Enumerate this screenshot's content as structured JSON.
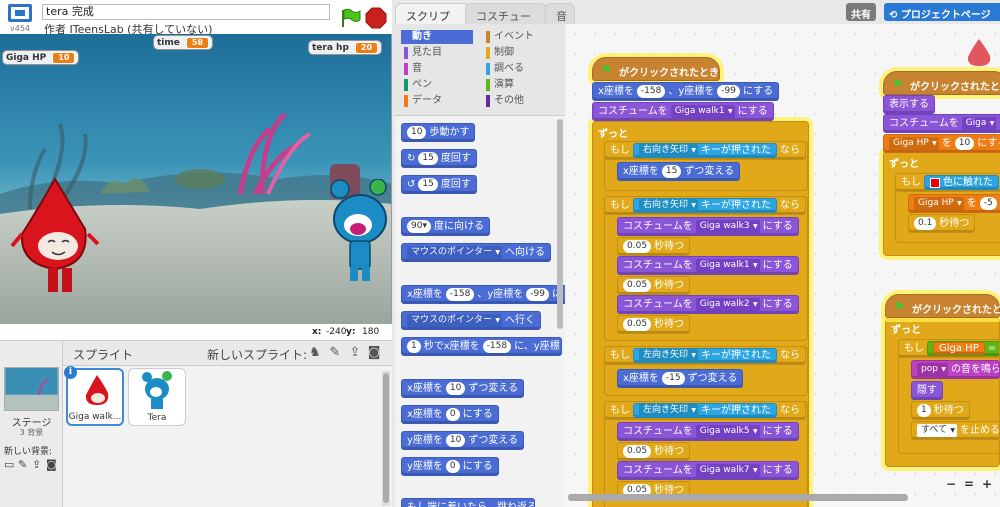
{
  "header": {
    "version": "v454",
    "project_title": "tera 完成",
    "author_line": "作者 ITeensLab (共有していない)"
  },
  "stage": {
    "monitors": [
      {
        "label": "Giga HP",
        "value": "10"
      },
      {
        "label": "time",
        "value": "58"
      },
      {
        "label": "tera hp",
        "value": "20"
      }
    ],
    "x_label": "x:",
    "x_value": "-240",
    "y_label": "y:",
    "y_value": "180"
  },
  "sprites": {
    "title": "スプライト",
    "new_sprite_label": "新しいスプライト:",
    "stage_label": "ステージ",
    "stage_backdrops": "3 背景",
    "new_backdrop_label": "新しい背景:",
    "items": [
      {
        "name": "Giga walk...",
        "selected": true
      },
      {
        "name": "Tera",
        "selected": false
      }
    ]
  },
  "tabs": [
    "スクリプト",
    "コスチューム",
    "音"
  ],
  "top_right": {
    "share": "共有",
    "project_page": "プロジェクトページ"
  },
  "categories": [
    {
      "label": "動き",
      "color": "#4a6cd4",
      "active": true
    },
    {
      "label": "見た目",
      "color": "#8a55d7"
    },
    {
      "label": "音",
      "color": "#bb42c3"
    },
    {
      "label": "ペン",
      "color": "#0e9a6c"
    },
    {
      "label": "データ",
      "color": "#ee7d16"
    },
    {
      "label": "イベント",
      "color": "#c88330"
    },
    {
      "label": "制御",
      "color": "#e1a91a"
    },
    {
      "label": "調べる",
      "color": "#2ca5e2"
    },
    {
      "label": "演算",
      "color": "#5cb712"
    },
    {
      "label": "その他",
      "color": "#632d99"
    }
  ],
  "palette": {
    "move": {
      "n": "10",
      "t": "歩動かす"
    },
    "turn_r": {
      "n": "15",
      "t": "度回す"
    },
    "turn_l": {
      "n": "15",
      "t": "度回す"
    },
    "point_dir": {
      "n": "90▾",
      "t": "度に向ける"
    },
    "point_towards": {
      "dd": "マウスのポインター",
      "t": "へ向ける"
    },
    "goto_xy": {
      "a": "x座標を",
      "x": "-158",
      "b": "、y座標を",
      "y": "-99",
      "c": "に"
    },
    "goto": {
      "dd": "マウスのポインター",
      "t": "へ行く"
    },
    "glide": {
      "n": "1",
      "a": "秒でx座標を",
      "x": "-158",
      "b": "に、y座標を"
    },
    "change_x": {
      "a": "x座標を",
      "n": "10",
      "b": "ずつ変える"
    },
    "set_x": {
      "a": "x座標を",
      "n": "0",
      "b": "にする"
    },
    "change_y": {
      "a": "y座標を",
      "n": "10",
      "b": "ずつ変える"
    },
    "set_y": {
      "a": "y座標を",
      "n": "0",
      "b": "にする"
    },
    "partial": "もし端に着いたら、跳ね返る"
  },
  "script1": {
    "hat": "がクリックされたとき",
    "goto": {
      "a": "x座標を",
      "x": "-158",
      "b": "、y座標を",
      "y": "-99",
      "c": "にする"
    },
    "costume": {
      "a": "コスチュームを",
      "dd": "Giga walk1",
      "b": "にする"
    },
    "forever": "ずっと",
    "if1": {
      "a": "もし",
      "key": "右向き矢印",
      "b": "キーが押された",
      "c": "なら"
    },
    "change1": {
      "a": "x座標を",
      "n": "15",
      "b": "ずつ変える"
    },
    "if2": {
      "a": "もし",
      "key": "右向き矢印",
      "b": "キーが押された",
      "c": "なら"
    },
    "seq": [
      {
        "a": "コスチュームを",
        "dd": "Giga walk3",
        "b": "にする"
      },
      {
        "n": "0.05",
        "t": "秒待つ"
      },
      {
        "a": "コスチュームを",
        "dd": "Giga walk1",
        "b": "にする"
      },
      {
        "n": "0.05",
        "t": "秒待つ"
      },
      {
        "a": "コスチュームを",
        "dd": "Giga walk2",
        "b": "にする"
      },
      {
        "n": "0.05",
        "t": "秒待つ"
      }
    ],
    "if3": {
      "a": "もし",
      "key": "左向き矢印",
      "b": "キーが押された",
      "c": "なら"
    },
    "change2": {
      "a": "x座標を",
      "n": "-15",
      "b": "ずつ変える"
    },
    "if4": {
      "a": "もし",
      "key": "左向き矢印",
      "b": "キーが押された",
      "c": "なら"
    },
    "seq2": [
      {
        "a": "コスチュームを",
        "dd": "Giga walk5",
        "b": "にする"
      },
      {
        "n": "0.05",
        "t": "秒待つ"
      },
      {
        "a": "コスチュームを",
        "dd": "Giga walk7",
        "b": "にする"
      },
      {
        "n": "0.05",
        "t": "秒待つ"
      }
    ]
  },
  "script2": {
    "hat": "がクリックされたとき",
    "show": "表示する",
    "costume": {
      "a": "コスチュームを",
      "dd": "Giga"
    },
    "setvar": {
      "dd": "Giga HP",
      "a": "を",
      "n": "10",
      "b": "にする"
    },
    "forever": "ずっと",
    "if": {
      "a": "もし",
      "b": "色に触れた"
    },
    "changevar": {
      "dd": "Giga HP",
      "a": "を",
      "n": "-5"
    },
    "wait": {
      "n": "0.1",
      "t": "秒待つ"
    }
  },
  "script3": {
    "hat": "がクリックされたと",
    "forever": "ずっと",
    "if": {
      "a": "もし",
      "var": "Giga HP",
      "op": "="
    },
    "sound": {
      "dd": "pop",
      "t": "の音を鳴らす"
    },
    "hide": "隠す",
    "wait": {
      "n": "1",
      "t": "秒待つ"
    },
    "stop": {
      "dd": "すべて",
      "t": "を止める"
    }
  },
  "zoom": {
    "minus": "−",
    "reset": "=",
    "plus": "+"
  }
}
